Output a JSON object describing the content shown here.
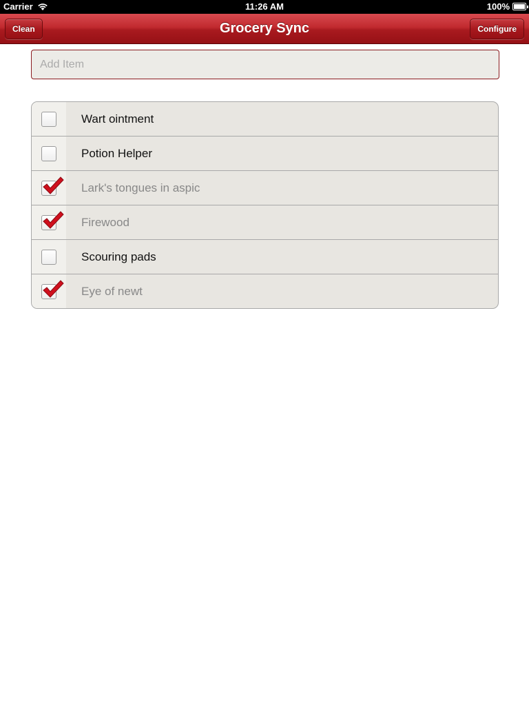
{
  "status_bar": {
    "carrier": "Carrier",
    "time": "11:26 AM",
    "battery": "100%",
    "wifi_icon": "wifi-icon",
    "battery_icon": "battery-icon"
  },
  "nav": {
    "title": "Grocery Sync",
    "left_button": "Clean",
    "right_button": "Configure",
    "color": "#b8222a"
  },
  "add_item": {
    "placeholder": "Add Item",
    "value": ""
  },
  "items": [
    {
      "label": "Wart ointment",
      "checked": false
    },
    {
      "label": "Potion Helper",
      "checked": false
    },
    {
      "label": "Lark's tongues in aspic",
      "checked": true
    },
    {
      "label": "Firewood",
      "checked": true
    },
    {
      "label": "Scouring pads",
      "checked": false
    },
    {
      "label": "Eye of newt",
      "checked": true
    }
  ],
  "colors": {
    "checkmark": "#d0101e",
    "checked_text": "#888888",
    "unchecked_text": "#111111"
  }
}
